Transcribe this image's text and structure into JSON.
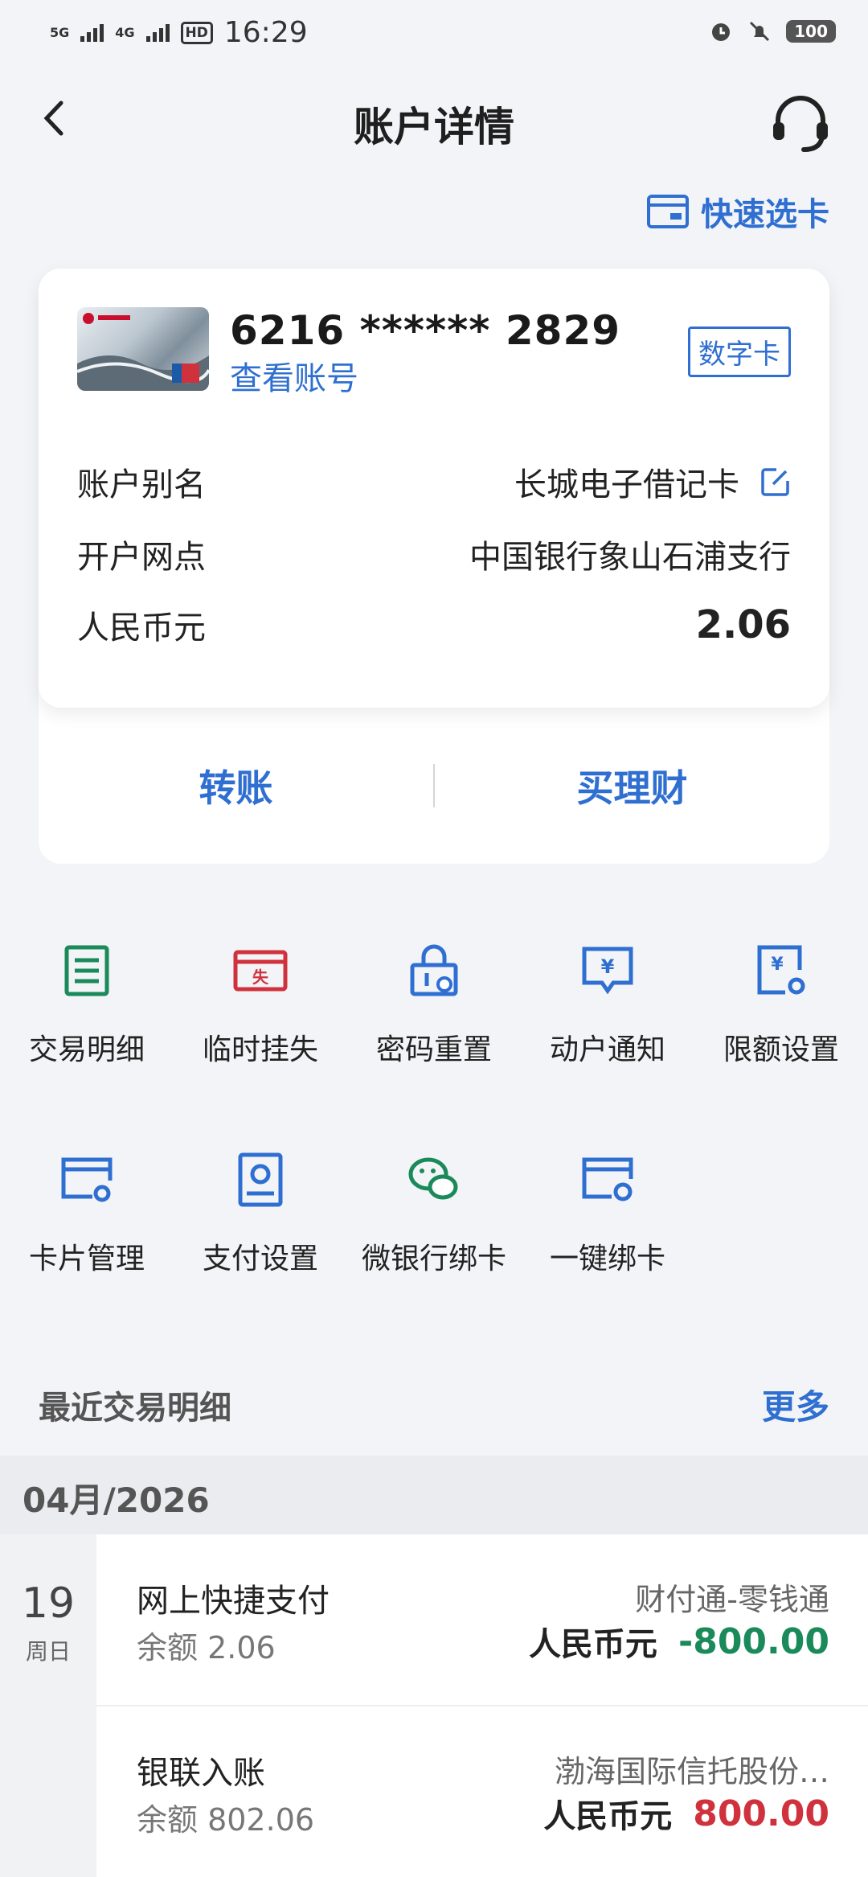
{
  "status": {
    "sim1": "5G",
    "sim2": "4G",
    "hd": "HD",
    "time": "16:29",
    "battery": "100"
  },
  "header": {
    "title": "账户详情"
  },
  "quick_card": "快速选卡",
  "card": {
    "number": "6216 ****** 2829",
    "view_account": "查看账号",
    "badge": "数字卡",
    "rows": [
      {
        "label": "账户别名",
        "value": "长城电子借记卡"
      },
      {
        "label": "开户网点",
        "value": "中国银行象山石浦支行"
      },
      {
        "label": "人民币元",
        "value": "2.06"
      }
    ],
    "actions": {
      "transfer": "转账",
      "wealth": "买理财"
    }
  },
  "grid": [
    {
      "label": "交易明细",
      "icon": "list-icon",
      "color": "#1a8a5a"
    },
    {
      "label": "临时挂失",
      "icon": "lost-icon",
      "color": "#d0323d"
    },
    {
      "label": "密码重置",
      "icon": "lock-reset-icon",
      "color": "#2f6fd1"
    },
    {
      "label": "动户通知",
      "icon": "notify-icon",
      "color": "#2f6fd1"
    },
    {
      "label": "限额设置",
      "icon": "limit-icon",
      "color": "#2f6fd1"
    },
    {
      "label": "卡片管理",
      "icon": "card-gear-icon",
      "color": "#2f6fd1"
    },
    {
      "label": "支付设置",
      "icon": "pay-settings-icon",
      "color": "#2f6fd1"
    },
    {
      "label": "微银行绑卡",
      "icon": "wechat-icon",
      "color": "#1a8a5a"
    },
    {
      "label": "一键绑卡",
      "icon": "bind-card-icon",
      "color": "#2f6fd1"
    }
  ],
  "recent": {
    "title": "最近交易明细",
    "more": "更多",
    "month": "04月/2026"
  },
  "date": {
    "day": "19",
    "weekday": "周日"
  },
  "transactions": [
    {
      "name": "网上快捷支付",
      "balance": "余额  2.06",
      "counterparty": "财付通-零钱通",
      "currency": "人民币元",
      "amount": "-800.00"
    },
    {
      "name": "银联入账",
      "balance": "余额  802.06",
      "counterparty": "渤海国际信托股份…",
      "currency": "人民币元",
      "amount": "800.00"
    }
  ],
  "colors": {
    "accent": "#2f6fd1",
    "negative": "#1a8a5a",
    "positive": "#d0323d"
  }
}
